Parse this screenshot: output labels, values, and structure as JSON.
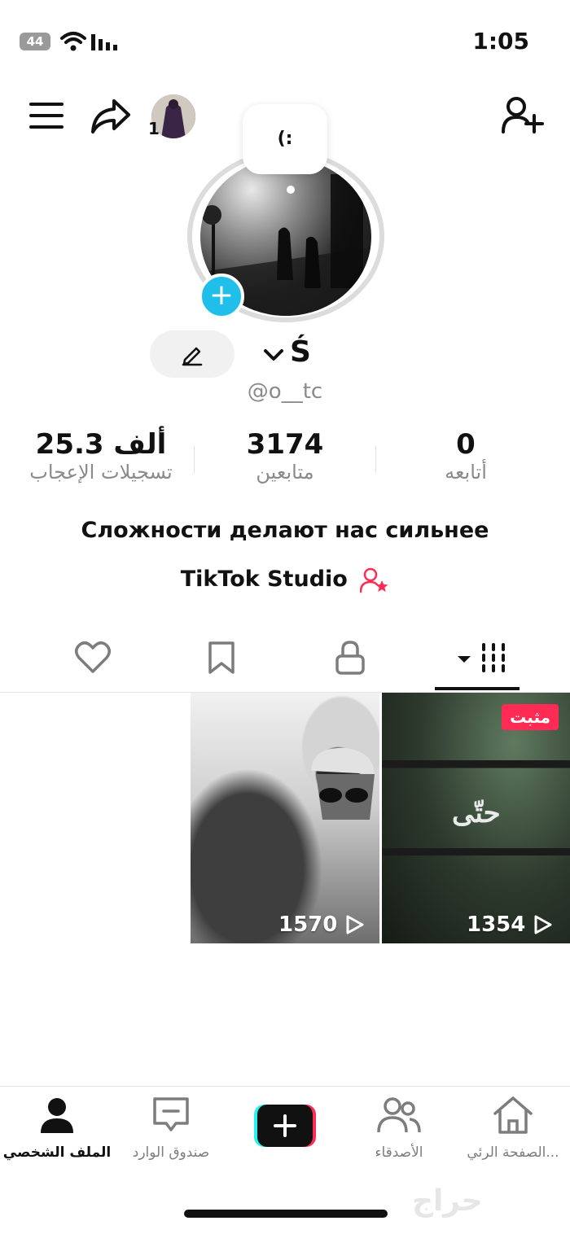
{
  "status_bar": {
    "time": "1:05",
    "battery_level": "44"
  },
  "header": {
    "story_count": "1"
  },
  "profile": {
    "bubble_text": "(:",
    "name": "Ś",
    "handle": "@o__tc",
    "bio": "Сложности делают нас сильнее",
    "studio_label": "TikTok Studio"
  },
  "stats": [
    {
      "value": "0",
      "label": "أتابعه"
    },
    {
      "value": "3174",
      "label": "متابعين"
    },
    {
      "value": "25.3 ألف",
      "label": "تسجيلات الإعجاب"
    }
  ],
  "videos": [
    {
      "views": "1354",
      "pinned_label": "مثبت",
      "overlay_text": "حتّى"
    },
    {
      "views": "1570"
    }
  ],
  "bottom_nav": [
    {
      "label": "الصفحة الرئي...",
      "icon": "home-icon"
    },
    {
      "label": "الأصدقاء",
      "icon": "friends-icon"
    },
    {
      "label": "",
      "icon": "create-icon"
    },
    {
      "label": "صندوق الوارد",
      "icon": "inbox-icon"
    },
    {
      "label": "الملف الشخصي",
      "icon": "profile-icon"
    }
  ],
  "watermark": "حراج",
  "colors": {
    "accent_red": "#fe2c55",
    "add_blue": "#1fbfea",
    "muted_text": "#8a8a8a"
  }
}
